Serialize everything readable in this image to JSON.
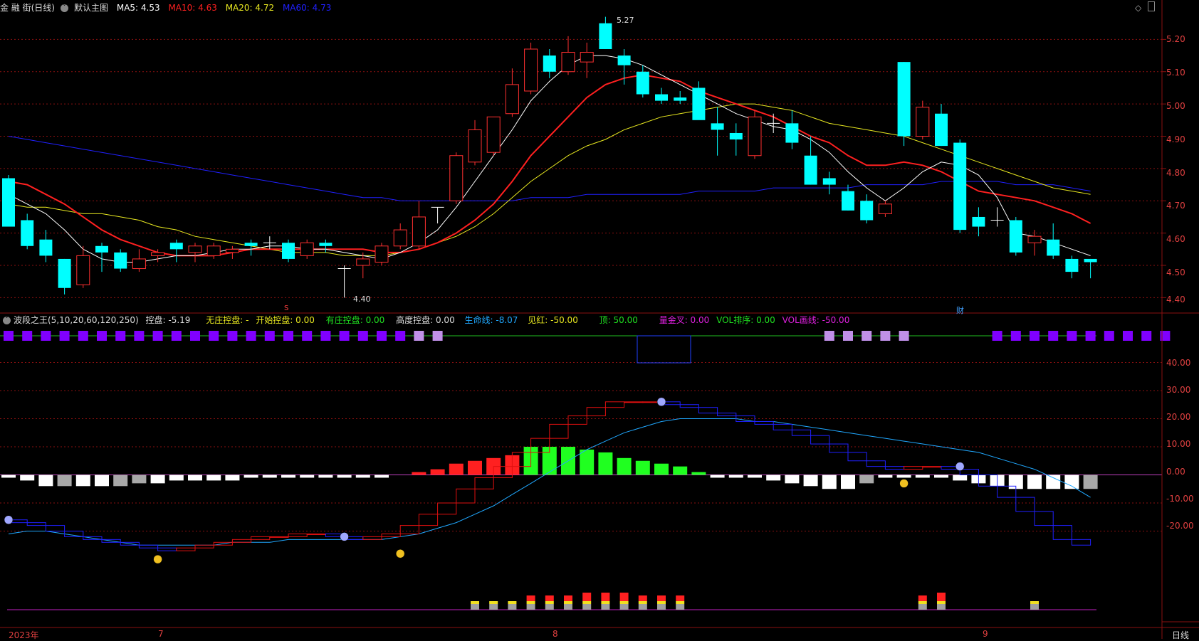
{
  "main_header": {
    "stock": "金 融 街(日线)",
    "template": "默认主图",
    "ma5": "MA5: 4.53",
    "ma10": "MA10: 4.63",
    "ma20": "MA20: 4.72",
    "ma60": "MA60: 4.73"
  },
  "indicator_header": {
    "name": "波段之王(5,10,20,60,120,250)",
    "kongpan": "控盘: -5.19",
    "wuzhuang": "无庄控盘: -",
    "kaishi": "开始控盘: 0.00",
    "youzhuang": "有庄控盘: 0.00",
    "gaodu": "高度控盘: 0.00",
    "shengming": "生命线: -8.07",
    "jianhong": "见红: -50.00",
    "ding": "顶: 50.00",
    "liangjincha": "量金叉: 0.00",
    "volpaixu": "VOL排序: 0.00",
    "volhuaxian": "VOL画线: -50.00"
  },
  "price_axis": [
    "5.20",
    "5.10",
    "5.00",
    "4.90",
    "4.80",
    "4.70",
    "4.60",
    "4.50",
    "4.40"
  ],
  "indicator_axis": [
    "40.00",
    "30.00",
    "20.00",
    "10.00",
    "0.00",
    "-10.00",
    "-20.00"
  ],
  "date_axis": [
    "2023年",
    "7",
    "8",
    "9"
  ],
  "period_label": "日线",
  "annotations": {
    "high": "5.27",
    "low": "4.40",
    "cai": "财",
    "s_mark": "S"
  },
  "colors": {
    "ma5": "#ffffff",
    "ma10": "#ff2020",
    "ma20": "#e8e820",
    "ma60": "#2020ff",
    "up": "#ff3030",
    "down": "#00ffff",
    "grid": "#8a1010"
  },
  "chart_data": {
    "type": "candlestick",
    "ohlc": [
      [
        4.77,
        4.78,
        4.62,
        4.62
      ],
      [
        4.64,
        4.66,
        4.55,
        4.56
      ],
      [
        4.58,
        4.61,
        4.51,
        4.53
      ],
      [
        4.52,
        4.52,
        4.41,
        4.43
      ],
      [
        4.44,
        4.56,
        4.43,
        4.53
      ],
      [
        4.56,
        4.57,
        4.48,
        4.54
      ],
      [
        4.54,
        4.55,
        4.48,
        4.49
      ],
      [
        4.49,
        4.55,
        4.48,
        4.52
      ],
      [
        4.53,
        4.55,
        4.51,
        4.54
      ],
      [
        4.57,
        4.58,
        4.51,
        4.55
      ],
      [
        4.54,
        4.57,
        4.51,
        4.56
      ],
      [
        4.53,
        4.57,
        4.52,
        4.56
      ],
      [
        4.54,
        4.56,
        4.52,
        4.55
      ],
      [
        4.57,
        4.58,
        4.53,
        4.56
      ],
      [
        4.57,
        4.59,
        4.55,
        4.57
      ],
      [
        4.57,
        4.58,
        4.51,
        4.52
      ],
      [
        4.53,
        4.58,
        4.52,
        4.57
      ],
      [
        4.57,
        4.58,
        4.54,
        4.56
      ],
      [
        4.49,
        4.5,
        4.4,
        4.49
      ],
      [
        4.5,
        4.54,
        4.46,
        4.52
      ],
      [
        4.51,
        4.57,
        4.5,
        4.56
      ],
      [
        4.56,
        4.63,
        4.55,
        4.61
      ],
      [
        4.56,
        4.7,
        4.55,
        4.65
      ],
      [
        4.68,
        4.68,
        4.63,
        4.68
      ],
      [
        4.7,
        4.85,
        4.69,
        4.84
      ],
      [
        4.82,
        4.95,
        4.81,
        4.92
      ],
      [
        4.85,
        4.96,
        4.84,
        4.96
      ],
      [
        4.97,
        5.11,
        4.96,
        5.06
      ],
      [
        5.04,
        5.19,
        5.03,
        5.17
      ],
      [
        5.15,
        5.17,
        5.08,
        5.1
      ],
      [
        5.1,
        5.21,
        5.09,
        5.16
      ],
      [
        5.13,
        5.19,
        5.08,
        5.16
      ],
      [
        5.25,
        5.27,
        5.17,
        5.17
      ],
      [
        5.15,
        5.17,
        5.06,
        5.12
      ],
      [
        5.1,
        5.12,
        5.02,
        5.03
      ],
      [
        5.03,
        5.05,
        5.0,
        5.01
      ],
      [
        5.02,
        5.04,
        5.0,
        5.01
      ],
      [
        5.05,
        5.07,
        4.96,
        4.95
      ],
      [
        4.94,
        4.99,
        4.84,
        4.92
      ],
      [
        4.91,
        4.94,
        4.84,
        4.89
      ],
      [
        4.84,
        4.98,
        4.83,
        4.96
      ],
      [
        4.94,
        4.97,
        4.91,
        4.94
      ],
      [
        4.94,
        4.98,
        4.86,
        4.88
      ],
      [
        4.84,
        4.9,
        4.75,
        4.75
      ],
      [
        4.77,
        4.79,
        4.72,
        4.75
      ],
      [
        4.73,
        4.75,
        4.67,
        4.67
      ],
      [
        4.7,
        4.72,
        4.63,
        4.64
      ],
      [
        4.66,
        4.7,
        4.65,
        4.69
      ],
      [
        5.13,
        5.13,
        4.87,
        4.9
      ],
      [
        4.9,
        5.01,
        4.89,
        4.99
      ],
      [
        4.97,
        5.0,
        4.87,
        4.87
      ],
      [
        4.88,
        4.89,
        4.6,
        4.61
      ],
      [
        4.65,
        4.68,
        4.59,
        4.62
      ],
      [
        4.64,
        4.68,
        4.62,
        4.64
      ],
      [
        4.64,
        4.65,
        4.53,
        4.54
      ],
      [
        4.57,
        4.61,
        4.53,
        4.59
      ],
      [
        4.58,
        4.63,
        4.52,
        4.53
      ],
      [
        4.52,
        4.53,
        4.46,
        4.48
      ],
      [
        4.52,
        4.52,
        4.46,
        4.51
      ]
    ],
    "ma5": [
      4.72,
      4.69,
      4.66,
      4.61,
      4.55,
      4.52,
      4.51,
      4.51,
      4.52,
      4.53,
      4.53,
      4.54,
      4.55,
      4.55,
      4.56,
      4.56,
      4.55,
      4.55,
      4.54,
      4.53,
      4.52,
      4.54,
      4.57,
      4.61,
      4.68,
      4.76,
      4.84,
      4.92,
      5.01,
      5.07,
      5.12,
      5.15,
      5.15,
      5.14,
      5.12,
      5.09,
      5.06,
      5.03,
      5.0,
      4.97,
      4.95,
      4.93,
      4.92,
      4.89,
      4.85,
      4.79,
      4.74,
      4.7,
      4.74,
      4.79,
      4.82,
      4.81,
      4.78,
      4.71,
      4.6,
      4.59,
      4.57,
      4.55,
      4.53
    ],
    "ma10": [
      4.76,
      4.75,
      4.72,
      4.69,
      4.65,
      4.61,
      4.58,
      4.56,
      4.54,
      4.53,
      4.53,
      4.53,
      4.54,
      4.55,
      4.55,
      4.55,
      4.55,
      4.55,
      4.55,
      4.55,
      4.54,
      4.54,
      4.55,
      4.57,
      4.6,
      4.64,
      4.69,
      4.76,
      4.84,
      4.9,
      4.96,
      5.02,
      5.06,
      5.08,
      5.09,
      5.08,
      5.07,
      5.04,
      5.02,
      5.0,
      4.98,
      4.96,
      4.93,
      4.9,
      4.88,
      4.84,
      4.81,
      4.81,
      4.82,
      4.81,
      4.79,
      4.76,
      4.73,
      4.72,
      4.71,
      4.7,
      4.68,
      4.66,
      4.63
    ],
    "ma20": [
      4.69,
      4.68,
      4.68,
      4.67,
      4.66,
      4.66,
      4.65,
      4.64,
      4.62,
      4.61,
      4.59,
      4.58,
      4.57,
      4.56,
      4.55,
      4.54,
      4.54,
      4.54,
      4.53,
      4.53,
      4.53,
      4.54,
      4.55,
      4.57,
      4.59,
      4.62,
      4.66,
      4.71,
      4.76,
      4.8,
      4.84,
      4.87,
      4.89,
      4.92,
      4.94,
      4.96,
      4.97,
      4.98,
      4.99,
      5.0,
      5.0,
      4.99,
      4.98,
      4.96,
      4.94,
      4.93,
      4.92,
      4.91,
      4.9,
      4.88,
      4.86,
      4.84,
      4.82,
      4.8,
      4.78,
      4.76,
      4.74,
      4.73,
      4.72
    ],
    "ma60": [
      4.9,
      4.89,
      4.88,
      4.87,
      4.86,
      4.85,
      4.84,
      4.83,
      4.82,
      4.81,
      4.8,
      4.79,
      4.78,
      4.77,
      4.76,
      4.75,
      4.74,
      4.73,
      4.72,
      4.71,
      4.71,
      4.7,
      4.7,
      4.7,
      4.7,
      4.7,
      4.7,
      4.7,
      4.71,
      4.71,
      4.71,
      4.72,
      4.72,
      4.72,
      4.72,
      4.72,
      4.72,
      4.73,
      4.73,
      4.73,
      4.73,
      4.74,
      4.74,
      4.74,
      4.74,
      4.74,
      4.75,
      4.75,
      4.75,
      4.75,
      4.76,
      4.76,
      4.76,
      4.76,
      4.75,
      4.75,
      4.75,
      4.74,
      4.73
    ],
    "ylim": [
      4.37,
      5.3
    ],
    "indicator": {
      "ylim": [
        -30,
        50
      ],
      "bars": [
        -1,
        -2,
        -4,
        -4,
        -4,
        -4,
        -4,
        -3,
        -3,
        -2,
        -2,
        -2,
        -2,
        -1,
        -1,
        -1,
        -1,
        -1,
        -1,
        -1,
        -1,
        0,
        1,
        2,
        4,
        5,
        6,
        7,
        10,
        10,
        10,
        9,
        8,
        6,
        5,
        4,
        3,
        1,
        -1,
        -1,
        -1,
        -2,
        -3,
        -4,
        -5,
        -5,
        -3,
        -1,
        -1,
        -1,
        -1,
        -2,
        -3,
        -4,
        -5,
        -5,
        -5,
        -5,
        -5
      ],
      "bar_colors": [
        "w",
        "w",
        "w",
        "g",
        "w",
        "w",
        "g",
        "g",
        "w",
        "w",
        "w",
        "w",
        "w",
        "w",
        "w",
        "w",
        "w",
        "w",
        "w",
        "w",
        "w",
        "r",
        "r",
        "r",
        "r",
        "r",
        "r",
        "r",
        "gr",
        "gr",
        "gr",
        "gr",
        "gr",
        "gr",
        "gr",
        "gr",
        "gr",
        "gr",
        "w",
        "w",
        "w",
        "w",
        "w",
        "w",
        "w",
        "w",
        "g",
        "w",
        "w",
        "w",
        "w",
        "w",
        "w",
        "w",
        "w",
        "w",
        "w",
        "w",
        "g"
      ],
      "life_line": [
        -21,
        -20,
        -20,
        -21,
        -22,
        -23,
        -24,
        -25,
        -25,
        -25,
        -25,
        -25,
        -24,
        -24,
        -24,
        -23,
        -23,
        -23,
        -23,
        -23,
        -23,
        -22,
        -21,
        -19,
        -17,
        -14,
        -11,
        -7,
        -3,
        1,
        5,
        9,
        12,
        15,
        17,
        19,
        20,
        20,
        20,
        20,
        19,
        19,
        18,
        17,
        16,
        15,
        14,
        13,
        12,
        11,
        10,
        9,
        8,
        6,
        4,
        2,
        -1,
        -4,
        -8
      ],
      "step_line": [
        -16,
        -17,
        -18,
        -20,
        -22,
        -23,
        -24,
        -25,
        -26,
        -27,
        -26,
        -25,
        -24,
        -23,
        -22,
        -22,
        -21,
        -21,
        -22,
        -23,
        -22,
        -21,
        -18,
        -14,
        -10,
        -5,
        -1,
        3,
        8,
        13,
        18,
        21,
        24,
        26,
        26,
        26,
        25,
        24,
        22,
        21,
        19,
        18,
        16,
        14,
        11,
        8,
        5,
        3,
        2,
        3,
        3,
        2,
        0,
        -4,
        -8,
        -13,
        -18,
        -23,
        -25
      ]
    },
    "kong_markers": [
      1,
      1,
      1,
      1,
      1,
      1,
      1,
      1,
      1,
      1,
      1,
      1,
      1,
      1,
      1,
      1,
      1,
      1,
      1,
      1,
      1,
      1,
      0.5,
      0.5,
      0,
      0,
      0,
      0,
      0,
      0,
      0,
      0,
      0,
      0,
      0,
      0,
      0,
      0,
      0,
      0,
      0,
      0,
      0,
      0,
      0.5,
      0.5,
      0.5,
      0.5,
      0.5,
      0,
      0,
      0,
      0,
      1,
      1,
      1,
      1,
      1,
      1,
      1,
      1,
      1,
      1
    ],
    "vol_bottom": [
      0,
      0,
      0,
      0,
      0,
      0,
      0,
      0,
      0,
      0,
      0,
      0,
      0,
      0,
      0,
      0,
      0,
      0,
      0,
      0,
      0,
      0,
      0,
      0,
      0,
      1,
      1,
      1,
      2,
      2,
      2,
      3,
      3,
      3,
      2,
      2,
      2,
      0,
      0,
      0,
      0,
      0,
      0,
      0,
      0,
      0,
      0,
      0,
      0,
      2,
      3,
      0,
      0,
      0,
      0,
      1,
      0,
      0,
      0
    ]
  }
}
